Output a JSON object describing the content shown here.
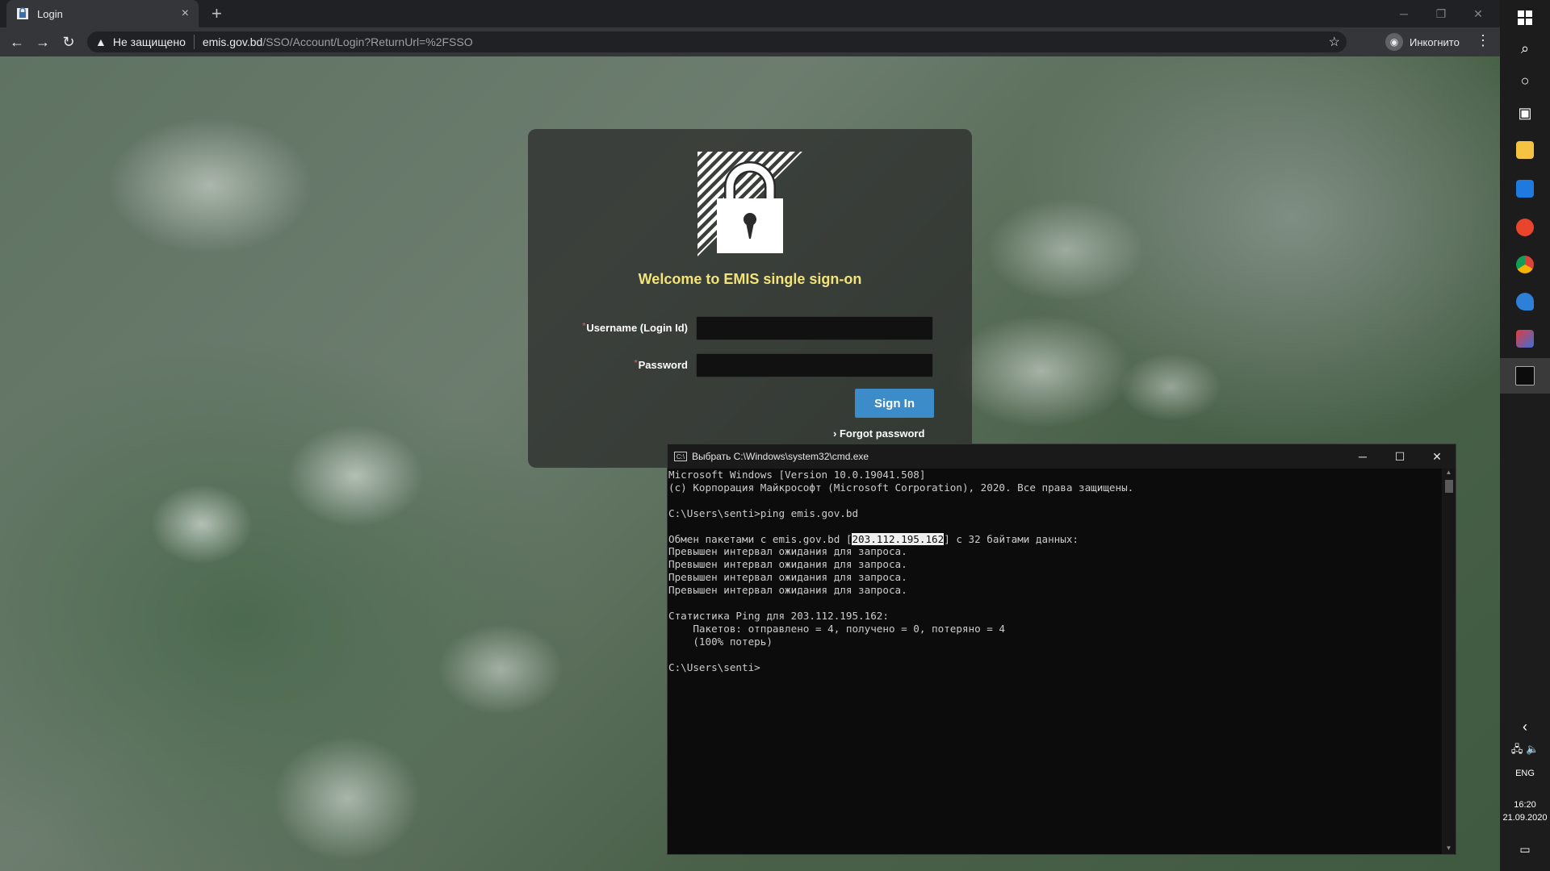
{
  "browser": {
    "tab_title": "Login",
    "tab_close": "×",
    "new_tab": "+",
    "security_label": "Не защищено",
    "url_host": "emis.gov.bd",
    "url_path": "/SSO/Account/Login?ReturnUrl=%2FSSO",
    "incognito_label": "Инкогнито",
    "window_controls": {
      "minimize": "─",
      "restore": "❐",
      "close": "✕"
    }
  },
  "login": {
    "welcome": "Welcome to EMIS single sign-on",
    "username_label": "Username (Login Id)",
    "password_label": "Password",
    "required_mark": "*",
    "signin_label": "Sign In",
    "forgot_label": "Forgot password",
    "accent_color": "#3b8cc8",
    "title_color": "#f2e37a"
  },
  "cmd": {
    "title": "Выбрать C:\\Windows\\system32\\cmd.exe",
    "lines": [
      "Microsoft Windows [Version 10.0.19041.508]",
      "(c) Корпорация Майкрософт (Microsoft Corporation), 2020. Все права защищены.",
      "",
      "C:\\Users\\senti>ping emis.gov.bd",
      "",
      "__HL__",
      "Превышен интервал ожидания для запроса.",
      "Превышен интервал ожидания для запроса.",
      "Превышен интервал ожидания для запроса.",
      "Превышен интервал ожидания для запроса.",
      "",
      "Статистика Ping для 203.112.195.162:",
      "    Пакетов: отправлено = 4, получено = 0, потеряно = 4",
      "    (100% потерь)",
      "",
      "C:\\Users\\senti>"
    ],
    "exchange_prefix": "Обмен пакетами с emis.gov.bd [",
    "selected_ip": "203.112.195.162",
    "exchange_suffix": "] с 32 байтами данных:",
    "controls": {
      "minimize": "─",
      "maximize": "☐",
      "close": "✕"
    }
  },
  "taskbar": {
    "language": "ENG",
    "time": "16:20",
    "date": "21.09.2020",
    "icons": [
      "windows-start-icon",
      "search-icon",
      "cortana-icon",
      "task-view-icon",
      "file-explorer-icon",
      "mail-icon",
      "yandex-browser-icon",
      "chrome-icon",
      "edge-icon",
      "pinned-app-icon",
      "cmd-app-icon"
    ]
  }
}
